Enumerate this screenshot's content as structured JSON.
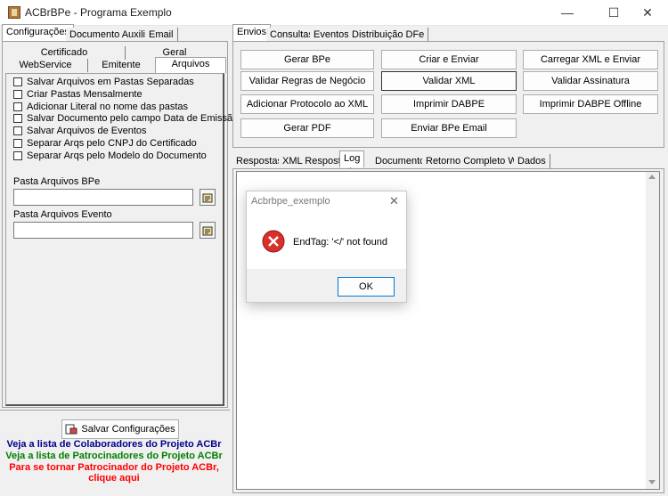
{
  "window": {
    "title": "ACBrBPe - Programa Exemplo",
    "minimize": "—",
    "maximize": "☐",
    "close": "✕"
  },
  "left_tabs": [
    "Configurações",
    "Documento Auxiliar",
    "Email"
  ],
  "config_tabs": {
    "row1": [
      "Certificado",
      "Geral"
    ],
    "row2": [
      "WebService",
      "Emitente",
      "Arquivos"
    ]
  },
  "checkboxes": [
    "Salvar Arquivos em Pastas Separadas",
    "Criar Pastas Mensalmente",
    "Adicionar Literal no nome das pastas",
    "Salvar Documento pelo campo Data de Emissão",
    "Salvar Arquivos de Eventos",
    "Separar Arqs pelo CNPJ do Certificado",
    "Separar Arqs pelo Modelo do Documento"
  ],
  "fields": {
    "pasta_bpe_label": "Pasta Arquivos BPe",
    "pasta_bpe_value": "",
    "pasta_evento_label": "Pasta Arquivos Evento",
    "pasta_evento_value": ""
  },
  "bottom": {
    "save_button": "Salvar Configurações",
    "link1": "Veja a lista de Colaboradores do Projeto ACBr",
    "link1_color": "#00008b",
    "link2": "Veja a lista de Patrocinadores do Projeto ACBr",
    "link2_color": "#008000",
    "link3a": "Para se tornar Patrocinador do Projeto ACBr,",
    "link3b": "clique aqui",
    "link3_color": "#ff0000"
  },
  "right_tabs": [
    "Envios",
    "Consultas",
    "Eventos",
    "Distribuição DFe"
  ],
  "action_buttons": [
    [
      "Gerar BPe",
      "Criar e Enviar",
      "Carregar XML e Enviar"
    ],
    [
      "Validar Regras de Negócio",
      "Validar XML",
      "Validar Assinatura"
    ],
    [
      "Adicionar Protocolo ao XML",
      "Imprimir DABPE",
      "Imprimir DABPE Offline"
    ],
    [
      "Gerar PDF",
      "Enviar BPe Email"
    ]
  ],
  "log_tabs": [
    "Respostas",
    "XML Resposta",
    "Log",
    "Documento",
    "Retorno Completo WS",
    "Dados"
  ],
  "dialog": {
    "title": "Acbrbpe_exemplo",
    "message": "EndTag: '</' not found",
    "ok": "OK",
    "icon": "error-icon"
  }
}
